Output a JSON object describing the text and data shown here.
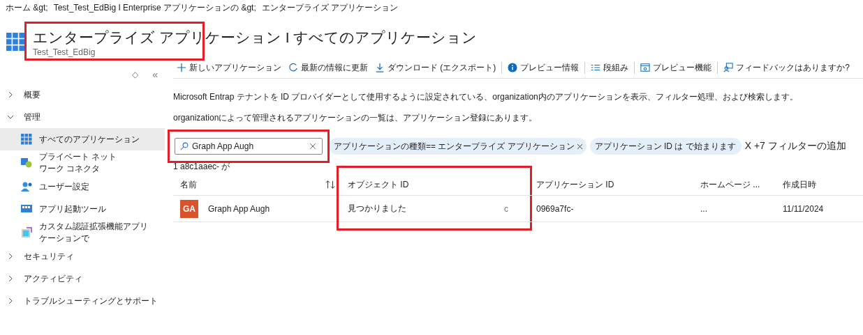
{
  "breadcrumb": [
    "ホーム &gt;",
    "Test_Test_EdBig I Enterprise アプリケーションの &gt;",
    "エンタープライズ アプリケーション"
  ],
  "header": {
    "title": "エンタープライズ アプリケーション I すべてのアプリケーション",
    "subtitle": "Test_Test_EdBig",
    "highlighted": true
  },
  "sidebar": {
    "sort_icon": "◇",
    "collapse": "«",
    "items": [
      {
        "label": "概要",
        "expanded": false
      },
      {
        "label": "管理",
        "expanded": true,
        "children": [
          {
            "label": "すべてのアプリケーション",
            "selected": true
          },
          {
            "label": "プライベート ネットワーク コネクタ",
            "selected": false
          },
          {
            "label": "ユーザー設定",
            "selected": false
          },
          {
            "label": "アプリ起動ツール",
            "selected": false
          },
          {
            "label": "カスタム認証拡張機能アプリケーションで",
            "selected": false
          }
        ]
      },
      {
        "label": "セキュリティ",
        "expanded": false
      },
      {
        "label": "アクティビティ",
        "expanded": false
      },
      {
        "label": "トラブルシューティングとサポート",
        "expanded": false
      }
    ]
  },
  "toolbar": [
    "新しいアプリケーション",
    "最新の情報に更新",
    "ダウンロード (エクスポート)",
    "プレビュー情報",
    "段組み",
    "プレビュー機能",
    "フィードバックはありますか?"
  ],
  "description": [
    "Microsoft Entrap テナントを ID プロバイダーとして使用するように設定されている、organization内のアプリケーションを表示、フィルター処理、および検索します。",
    "organizationによって管理されるアプリケーションの一覧は、アプリケーション登録にあります。"
  ],
  "search": {
    "value": "Graph App Augh",
    "highlighted": true
  },
  "filters": [
    {
      "label": "アプリケーションの種類== エンタープライズ アプリケーション",
      "removable": true
    },
    {
      "label": "アプリケーション ID は で始まります",
      "removable": false
    }
  ],
  "add_filter": "X +7 フィルターの追加",
  "result_count": "1 a8c1aaec- が",
  "table": {
    "columns": [
      {
        "label": "名前",
        "sortable": true,
        "highlighted": false
      },
      {
        "label": "オブジェクト ID",
        "sortable": false,
        "highlighted": true
      },
      {
        "label": "アプリケーション ID",
        "sortable": false,
        "highlighted": false
      },
      {
        "label": "ホームページ ...",
        "sortable": false,
        "highlighted": false
      },
      {
        "label": "作成日時",
        "sortable": false,
        "highlighted": false
      }
    ],
    "rows": [
      {
        "avatar": "GA",
        "cells": [
          "Graph App Augh",
          "見つかりました",
          "0969a7fc-",
          "...",
          "11/11/2024"
        ],
        "object_id_tail": "c"
      }
    ]
  }
}
